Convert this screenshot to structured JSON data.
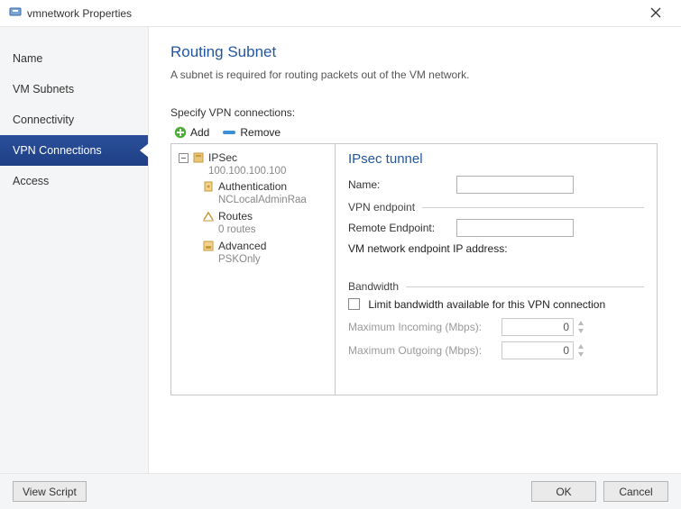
{
  "window": {
    "title": "vmnetwork Properties"
  },
  "sidebar": {
    "items": [
      {
        "label": "Name",
        "active": false
      },
      {
        "label": "VM Subnets",
        "active": false
      },
      {
        "label": "Connectivity",
        "active": false
      },
      {
        "label": "VPN Connections",
        "active": true
      },
      {
        "label": "Access",
        "active": false
      }
    ]
  },
  "main": {
    "heading": "Routing Subnet",
    "description": "A subnet is required for routing packets out of the VM network.",
    "section_label": "Specify VPN connections:",
    "toolbar": {
      "add": "Add",
      "remove": "Remove"
    },
    "tree": {
      "root": {
        "label": "IPSec",
        "sub": "100.100.100.100"
      },
      "children": [
        {
          "label": "Authentication",
          "sub": "NCLocalAdminRaa"
        },
        {
          "label": "Routes",
          "sub": "0 routes"
        },
        {
          "label": "Advanced",
          "sub": "PSKOnly"
        }
      ]
    },
    "detail": {
      "heading": "IPsec tunnel",
      "name_label": "Name:",
      "name_value": "",
      "group_endpoint": "VPN endpoint",
      "remote_label": "Remote Endpoint:",
      "remote_value": "",
      "vm_ep_label": "VM network endpoint IP address:",
      "group_bandwidth": "Bandwidth",
      "limit_label": "Limit bandwidth available for this VPN connection",
      "max_in_label": "Maximum Incoming (Mbps):",
      "max_in_value": "0",
      "max_out_label": "Maximum Outgoing (Mbps):",
      "max_out_value": "0"
    }
  },
  "footer": {
    "view_script": "View Script",
    "ok": "OK",
    "cancel": "Cancel"
  }
}
